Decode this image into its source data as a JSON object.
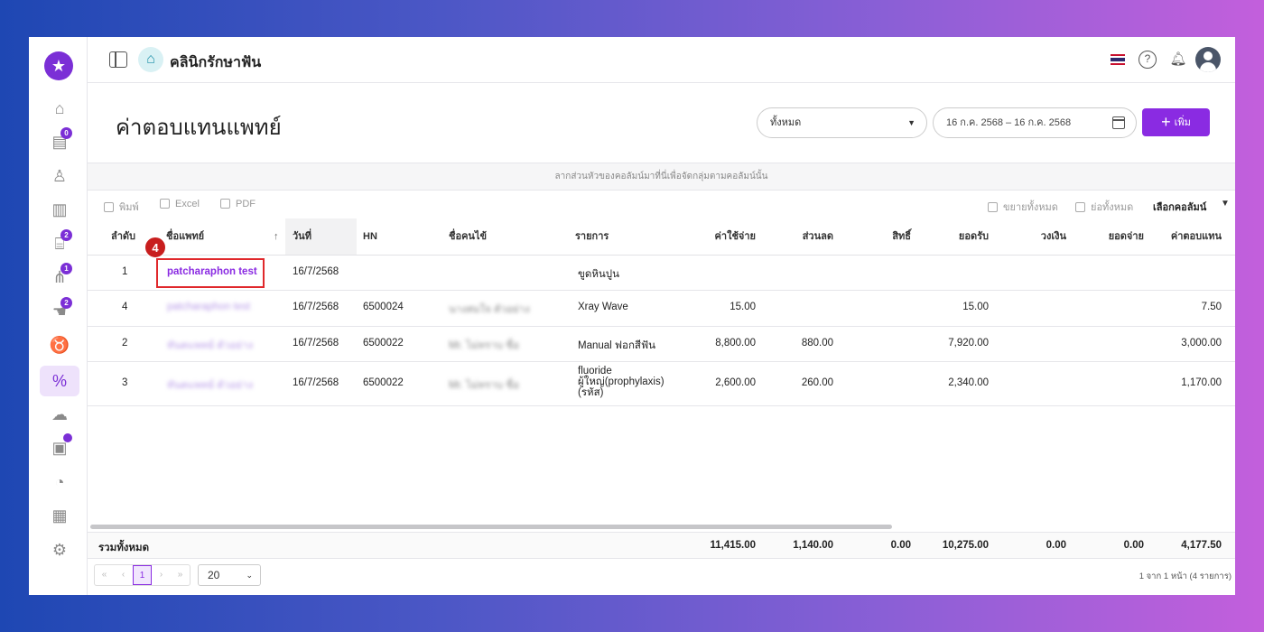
{
  "app": {
    "clinic_name": "คลินิกรักษาฟัน"
  },
  "sidebar": {
    "items": [
      {
        "icon": "home-icon",
        "badge": ""
      },
      {
        "icon": "calendar-icon",
        "badge": "0"
      },
      {
        "icon": "user-icon",
        "badge": ""
      },
      {
        "icon": "board-icon",
        "badge": ""
      },
      {
        "icon": "bed-icon",
        "badge": "2"
      },
      {
        "icon": "tools-icon",
        "badge": "1"
      },
      {
        "icon": "hand-money-icon",
        "badge": "2"
      },
      {
        "icon": "tooth-icon",
        "badge": ""
      },
      {
        "icon": "percent-icon",
        "badge": ""
      },
      {
        "icon": "cloud-icon",
        "badge": ""
      },
      {
        "icon": "box-icon",
        "badge": "•"
      },
      {
        "icon": "gauge-icon",
        "badge": ""
      },
      {
        "icon": "report-icon",
        "badge": ""
      },
      {
        "icon": "settings-icon",
        "badge": ""
      }
    ]
  },
  "header": {
    "title": "ค่าตอบแทนแพทย์",
    "filter_value": "ทั้งหมด",
    "date_range": "16 ก.ค. 2568 – 16 ก.ค. 2568",
    "add_label": "เพิ่ม"
  },
  "grid": {
    "group_hint": "ลากส่วนหัวของคอลัมน์มาที่นี่เพื่อจัดกลุ่มตามคอลัมน์นั้น",
    "toolbar": {
      "print": "พิมพ์",
      "excel": "Excel",
      "pdf": "PDF",
      "expand_all": "ขยายทั้งหมด",
      "collapse_all": "ย่อทั้งหมด",
      "choose_columns": "เลือกคอลัมน์"
    },
    "columns": {
      "order": "ลำดับ",
      "doctor": "ชื่อแพทย์",
      "date": "วันที่",
      "hn": "HN",
      "patient": "ชื่อคนไข้",
      "item": "รายการ",
      "cost": "ค่าใช้จ่าย",
      "discount": "ส่วนลด",
      "rights": "สิทธิ์",
      "received": "ยอดรับ",
      "deposit": "วงเงิน",
      "paid": "ยอดจ่าย",
      "fee": "ค่าตอบแทน"
    },
    "rows": [
      {
        "order": "1",
        "doctor": "patcharaphon test",
        "date": "16/7/2568",
        "hn": "",
        "patient": "",
        "item": "ขูดหินปูน",
        "item2": "",
        "item3": "",
        "cost": "",
        "discount": "",
        "received": "",
        "fee": ""
      },
      {
        "order": "4",
        "doctor": "patcharaphon test",
        "date": "16/7/2568",
        "hn": "6500024",
        "patient": "นางสมใจ ตัวอย่าง",
        "item": "Xray Wave",
        "item2": "",
        "item3": "",
        "cost": "15.00",
        "discount": "",
        "received": "15.00",
        "fee": "7.50"
      },
      {
        "order": "2",
        "doctor": "ทันตแพทย์ ตัวอย่าง",
        "date": "16/7/2568",
        "hn": "6500022",
        "patient": "Mr. ไม่ทราบ ชื่อ",
        "item": "Manual ฟอกสีฟัน",
        "item2": "",
        "item3": "",
        "cost": "8,800.00",
        "discount": "880.00",
        "received": "7,920.00",
        "fee": "3,000.00"
      },
      {
        "order": "3",
        "doctor": "ทันตแพทย์ ตัวอย่าง",
        "date": "16/7/2568",
        "hn": "6500022",
        "patient": "Mr. ไม่ทราบ ชื่อ",
        "item": "fluoride",
        "item2": "ผู้ใหญ่(prophylaxis)",
        "item3": "(รหัส)",
        "cost": "2,600.00",
        "discount": "260.00",
        "received": "2,340.00",
        "fee": "1,170.00"
      }
    ],
    "totals": {
      "label": "รวมทั้งหมด",
      "cost": "11,415.00",
      "discount": "1,140.00",
      "rights": "0.00",
      "received": "10,275.00",
      "deposit": "0.00",
      "paid": "0.00",
      "fee": "4,177.50"
    },
    "pager": {
      "current_page": "1",
      "page_size": "20",
      "info": "1 จาก 1 หน้า (4 รายการ)"
    }
  },
  "annotation": {
    "step": "4"
  },
  "colors": {
    "accent": "#8a2be2",
    "highlight": "#e0282b"
  }
}
